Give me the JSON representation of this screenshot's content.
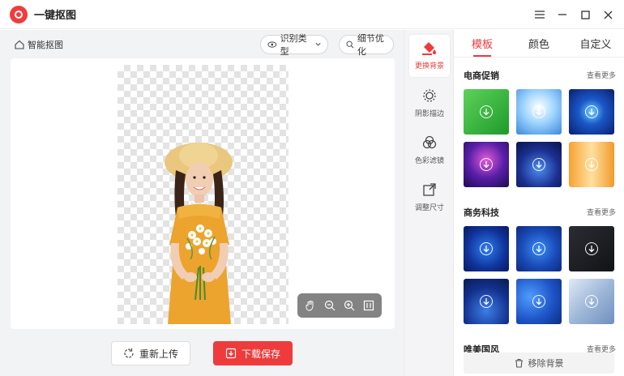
{
  "app": {
    "title": "一键抠图"
  },
  "toolbar": {
    "smart_label": "智能抠图",
    "type_label": "识别类型",
    "refine_label": "细节优化"
  },
  "actions": {
    "reupload_label": "重新上传",
    "save_label": "下载保存"
  },
  "tools": [
    {
      "label": "更换背景",
      "icon": "bucket-icon",
      "active": true
    },
    {
      "label": "阴影描边",
      "icon": "shadow-stroke-icon"
    },
    {
      "label": "色彩滤镜",
      "icon": "color-filter-icon"
    },
    {
      "label": "调整尺寸",
      "icon": "resize-icon"
    }
  ],
  "panel": {
    "tabs": [
      "模板",
      "颜色",
      "自定义"
    ],
    "sections": [
      {
        "title": "电商促销",
        "more": "查看更多"
      },
      {
        "title": "商务科技",
        "more": "查看更多"
      },
      {
        "title": "唯美国风",
        "more": "查看更多"
      }
    ],
    "remove_label": "移除背景"
  },
  "colors": {
    "accent": "#ee3b3b"
  }
}
